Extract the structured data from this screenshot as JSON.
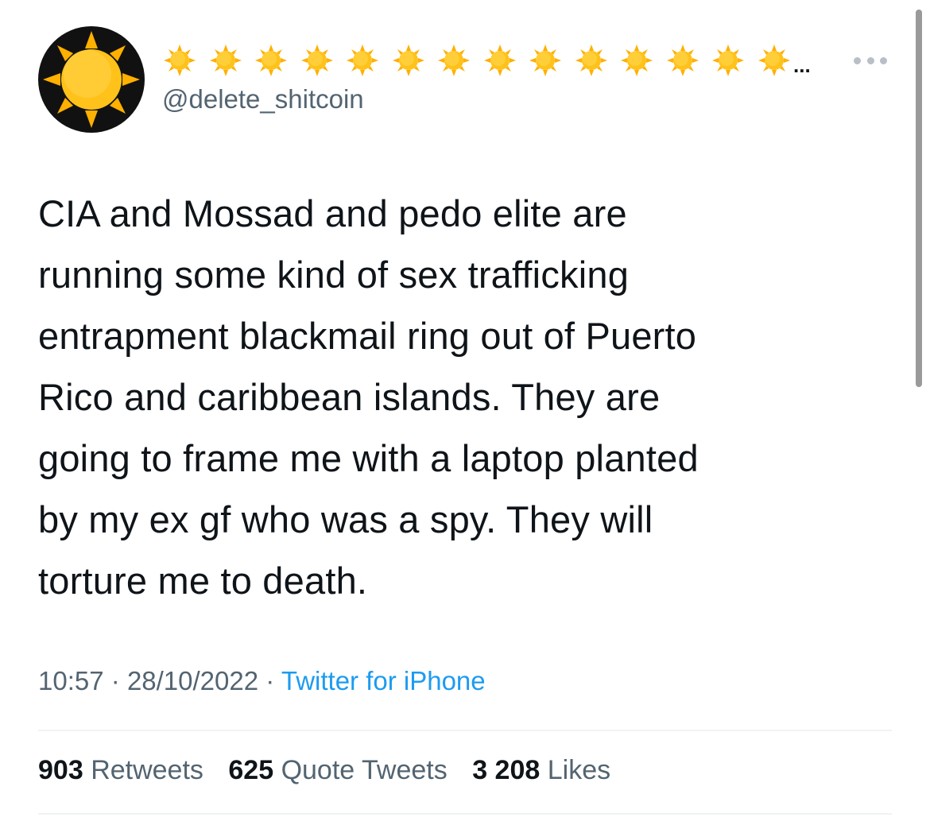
{
  "tweet": {
    "author": {
      "display_name_icons": [
        "sun-icon",
        "sun-icon",
        "sun-icon",
        "sun-icon",
        "sun-icon",
        "sun-icon",
        "sun-icon",
        "sun-icon",
        "sun-icon",
        "sun-icon",
        "sun-icon",
        "sun-icon",
        "sun-icon",
        "sun-icon"
      ],
      "display_name_ellipsis": "...",
      "handle": "@delete_shitcoin",
      "avatar_icon": "sun-icon"
    },
    "text_lines": [
      "CIA and Mossad and pedo elite are",
      "running some kind of sex trafficking",
      "entrapment blackmail ring out of Puerto",
      "Rico and caribbean islands. They are",
      "going to frame me with a laptop planted",
      "by my ex gf who was a spy. They will",
      "torture me to death."
    ],
    "time": "10:57",
    "separator": "·",
    "date": "28/10/2022",
    "source": "Twitter for iPhone",
    "stats": {
      "retweets_count": "903",
      "retweets_label": "Retweets",
      "quotes_count": "625",
      "quotes_label": "Quote Tweets",
      "likes_count": "3 208",
      "likes_label": "Likes"
    }
  },
  "colors": {
    "text": "#0f1419",
    "secondary": "#536471",
    "link": "#1d9bf0",
    "sun": "#ffc21a",
    "avatar_bg": "#111111"
  }
}
